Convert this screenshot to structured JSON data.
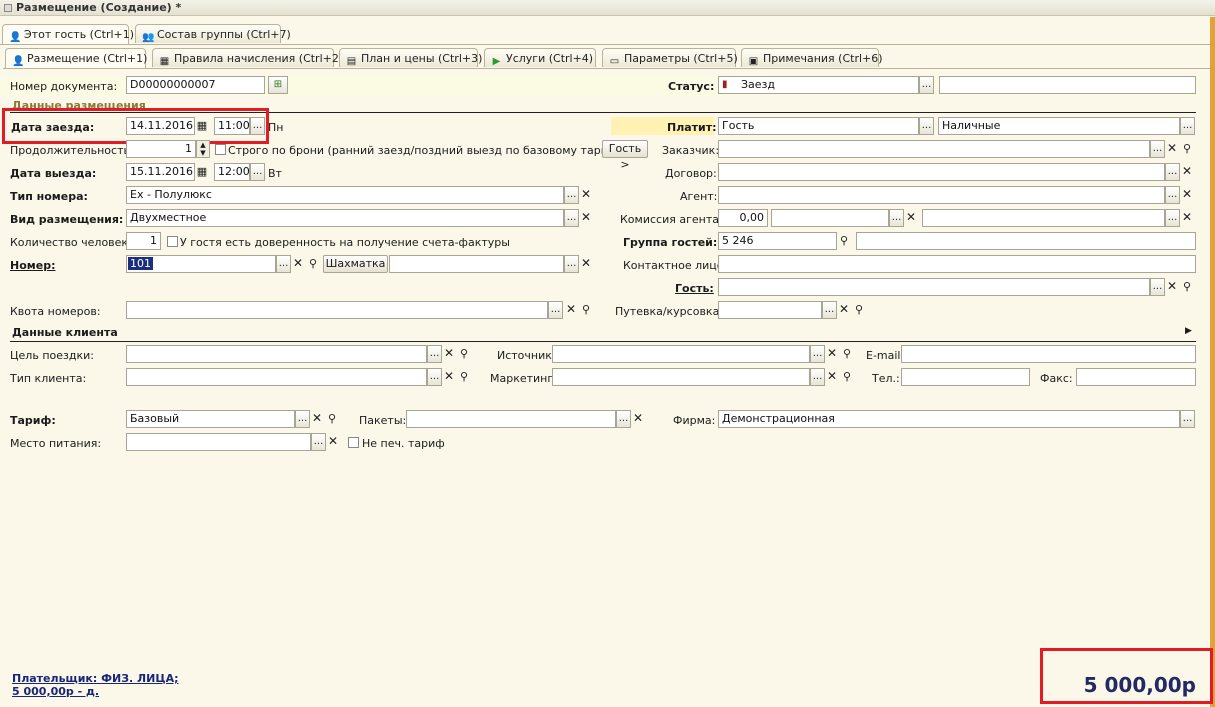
{
  "window": {
    "title": "Размещение (Создание) *"
  },
  "top_tabs": [
    {
      "label": "Этот гость (Ctrl+1)"
    },
    {
      "label": "Состав группы (Ctrl+7)"
    }
  ],
  "sub_tabs": [
    {
      "label": "Размещение (Ctrl+1)"
    },
    {
      "label": "Правила начисления (Ctrl+2)"
    },
    {
      "label": "План и цены (Ctrl+3)"
    },
    {
      "label": "Услуги (Ctrl+4)"
    },
    {
      "label": "Параметры (Ctrl+5)"
    },
    {
      "label": "Примечания (Ctrl+6)"
    }
  ],
  "doc": {
    "number_label": "Номер документа:",
    "number": "D00000000007"
  },
  "status": {
    "label": "Статус:",
    "value": "Заезд",
    "extra": ""
  },
  "section_placement": "Данные размещения",
  "checkin": {
    "label": "Дата заезда:",
    "date": "14.11.2016",
    "time": "11:00",
    "weekday": "Пн"
  },
  "duration": {
    "label": "Продолжительность:",
    "value": "1",
    "strict_label": "Строго по брони (ранний заезд/поздний выезд по базовому тарифу)",
    "guest_button": "Гость >"
  },
  "checkout": {
    "label": "Дата выезда:",
    "date": "15.11.2016",
    "time": "12:00",
    "weekday": "Вт"
  },
  "room_type": {
    "label": "Тип номера:",
    "value": "Ex - Полулюкс"
  },
  "accommodation": {
    "label": "Вид размещения:",
    "value": "Двухместное"
  },
  "persons": {
    "label": "Количество человек:",
    "value": "1",
    "power_label": "У гостя есть доверенность на получение счета-фактуры"
  },
  "room": {
    "label": "Номер:",
    "value": "101",
    "chess_button": "Шахматка",
    "extra": ""
  },
  "quota": {
    "label": "Квота номеров:",
    "value": ""
  },
  "payer": {
    "label": "Платит:",
    "value": "Гость",
    "method": "Наличные"
  },
  "customer": {
    "label": "Заказчик:",
    "value": ""
  },
  "contract": {
    "label": "Договор:",
    "value": ""
  },
  "agent": {
    "label": "Агент:",
    "value": ""
  },
  "agent_fee": {
    "label": "Комиссия агента:",
    "value": "0,00",
    "type": "",
    "extra": ""
  },
  "guest_group": {
    "label": "Группа гостей:",
    "value": "5 246",
    "extra": ""
  },
  "contact": {
    "label": "Контактное лицо:",
    "value": ""
  },
  "guest": {
    "label": "Гость:",
    "value": ""
  },
  "voucher": {
    "label": "Путевка/курсовка:",
    "value": ""
  },
  "section_client": "Данные клиента",
  "client": {
    "purpose_label": "Цель поездки:",
    "source_label": "Источник:",
    "email_label": "E-mail:",
    "type_label": "Тип клиента:",
    "marketing_label": "Маркетинг:",
    "phone_label": "Тел.:",
    "fax_label": "Факс:"
  },
  "tariff": {
    "label": "Тариф:",
    "value": "Базовый"
  },
  "packages": {
    "label": "Пакеты:",
    "value": ""
  },
  "firm": {
    "label": "Фирма:",
    "value": "Демонстрационная"
  },
  "meal": {
    "label": "Место питания:",
    "value": "",
    "no_print_label": "Не печ. тариф"
  },
  "footer": {
    "payer_line": "Плательщик: ФИЗ. ЛИЦА;",
    "amount_line": "5 000,00р - д.",
    "total": "5 000,00р"
  },
  "colors": {
    "highlight_red": "#e21b24",
    "accent_orange": "#e3a13c",
    "total_blue": "#232a63",
    "bg": "#fbf8ea"
  }
}
